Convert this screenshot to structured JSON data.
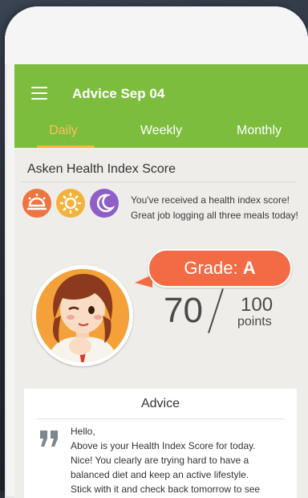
{
  "header": {
    "title": "Advice Sep 04"
  },
  "tabs": [
    {
      "label": "Daily",
      "active": true
    },
    {
      "label": "Weekly",
      "active": false
    },
    {
      "label": "Monthly",
      "active": false
    }
  ],
  "score_section": {
    "title": "Asken Health Index Score",
    "badges": [
      "sunrise-icon",
      "sun-icon",
      "moon-icon"
    ],
    "message_line1": "You've received a health index score!",
    "message_line2": "Great job logging all three meals today!"
  },
  "grade": {
    "prefix": "Grade: ",
    "value": "A"
  },
  "score": {
    "value": "70",
    "max": "100",
    "unit": "points"
  },
  "advice": {
    "title": "Advice",
    "lines": [
      "Hello,",
      "Above is your Health Index Score for today.",
      "Nice! You clearly are trying hard to have a",
      "balanced diet and keep an active lifestyle.",
      "Stick with it and check back tomorrow to see"
    ]
  },
  "colors": {
    "appbar": "#7dbd3e",
    "active_tab": "#f7c35a",
    "grade_bubble": "#f36b45"
  }
}
